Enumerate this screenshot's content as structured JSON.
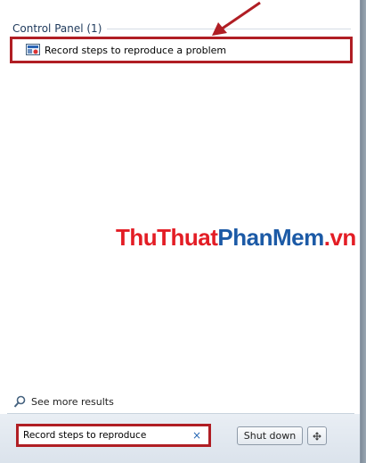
{
  "start_menu": {
    "group": {
      "title": "Control Panel (1)"
    },
    "results": [
      {
        "label": "Record steps to reproduce a problem",
        "icon": "steps-recorder-icon"
      }
    ],
    "see_more": {
      "label": "See more results",
      "icon": "search-icon"
    },
    "search": {
      "value": "Record steps to reproduce",
      "clear_glyph": "×",
      "clear_icon": "clear-icon"
    },
    "shutdown": {
      "label": "Shut down",
      "arrow_icon": "shutdown-options-icon"
    }
  },
  "watermark": {
    "part1": "ThuThuat",
    "part2": "PhanMem",
    "part3": ".vn"
  },
  "colors": {
    "highlight": "#b01e24",
    "group_title": "#1e395b",
    "watermark_red": "#e31d25",
    "watermark_blue": "#1c5aa6"
  }
}
